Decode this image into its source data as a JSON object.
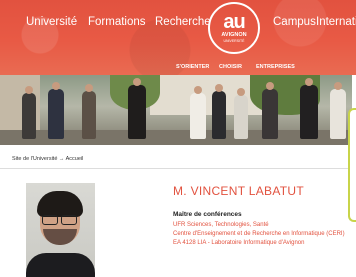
{
  "nav": {
    "items": [
      {
        "label": "Université"
      },
      {
        "label": "Formations"
      },
      {
        "label": "Recherche"
      },
      {
        "label": "Campus"
      },
      {
        "label": "Internatio"
      }
    ],
    "logo": {
      "mark": "au",
      "name": "AVIGNON",
      "sub": "UNIVERSITÉ"
    },
    "subnav": [
      {
        "label": "S'ORIENTER"
      },
      {
        "label": "CHOISIR"
      },
      {
        "label": "ENTREPRISES"
      }
    ]
  },
  "breadcrumb": "Site de l'Université → Accueil",
  "profile": {
    "name": "M. VINCENT LABATUT",
    "role": "Maître de conférences",
    "affiliations": [
      "UFR Sciences, Technologies, Santé",
      "Centre d'Enseignement et de Recherche en Informatique (CERI)",
      "EA 4128 LIA - Laboratoire Informatique d'Avignon"
    ]
  },
  "colors": {
    "brand": "#e2523f",
    "accent_green": "#c8d44a"
  }
}
